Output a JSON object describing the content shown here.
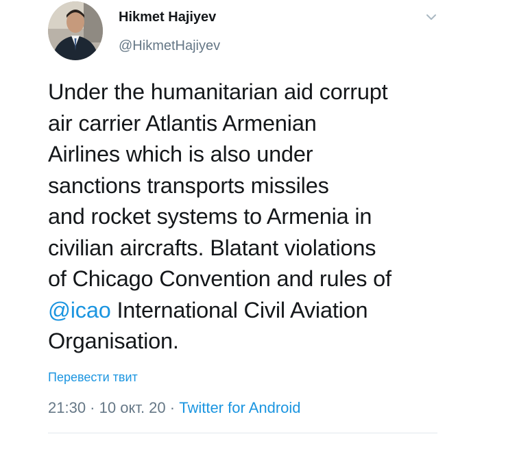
{
  "tweet": {
    "author": {
      "display_name": "Hikmet Hajiyev",
      "handle": "@HikmetHajiyev",
      "avatar_icon": "user-avatar-photo"
    },
    "menu_icon": "chevron-down-icon",
    "text_lines": [
      "Under the humanitarian aid corrupt",
      "air carrier Atlantis Armenian",
      "Airlines which is also under",
      "sanctions transports missiles",
      "and rocket systems to Armenia in",
      "civilian aircrafts. Blatant violations",
      "of Chicago Convention and rules of"
    ],
    "mention": "@icao",
    "line8_rest": " International Civil Aviation",
    "line9": "Organisation.",
    "translate_label": "Перевести твит",
    "time": "21:30",
    "separator": " · ",
    "date": "10 окт. 20",
    "source": "Twitter for Android"
  },
  "colors": {
    "link": "#1b95e0",
    "secondary_text": "#657786",
    "primary_text": "#14171a",
    "divider": "#e1e8ed"
  }
}
